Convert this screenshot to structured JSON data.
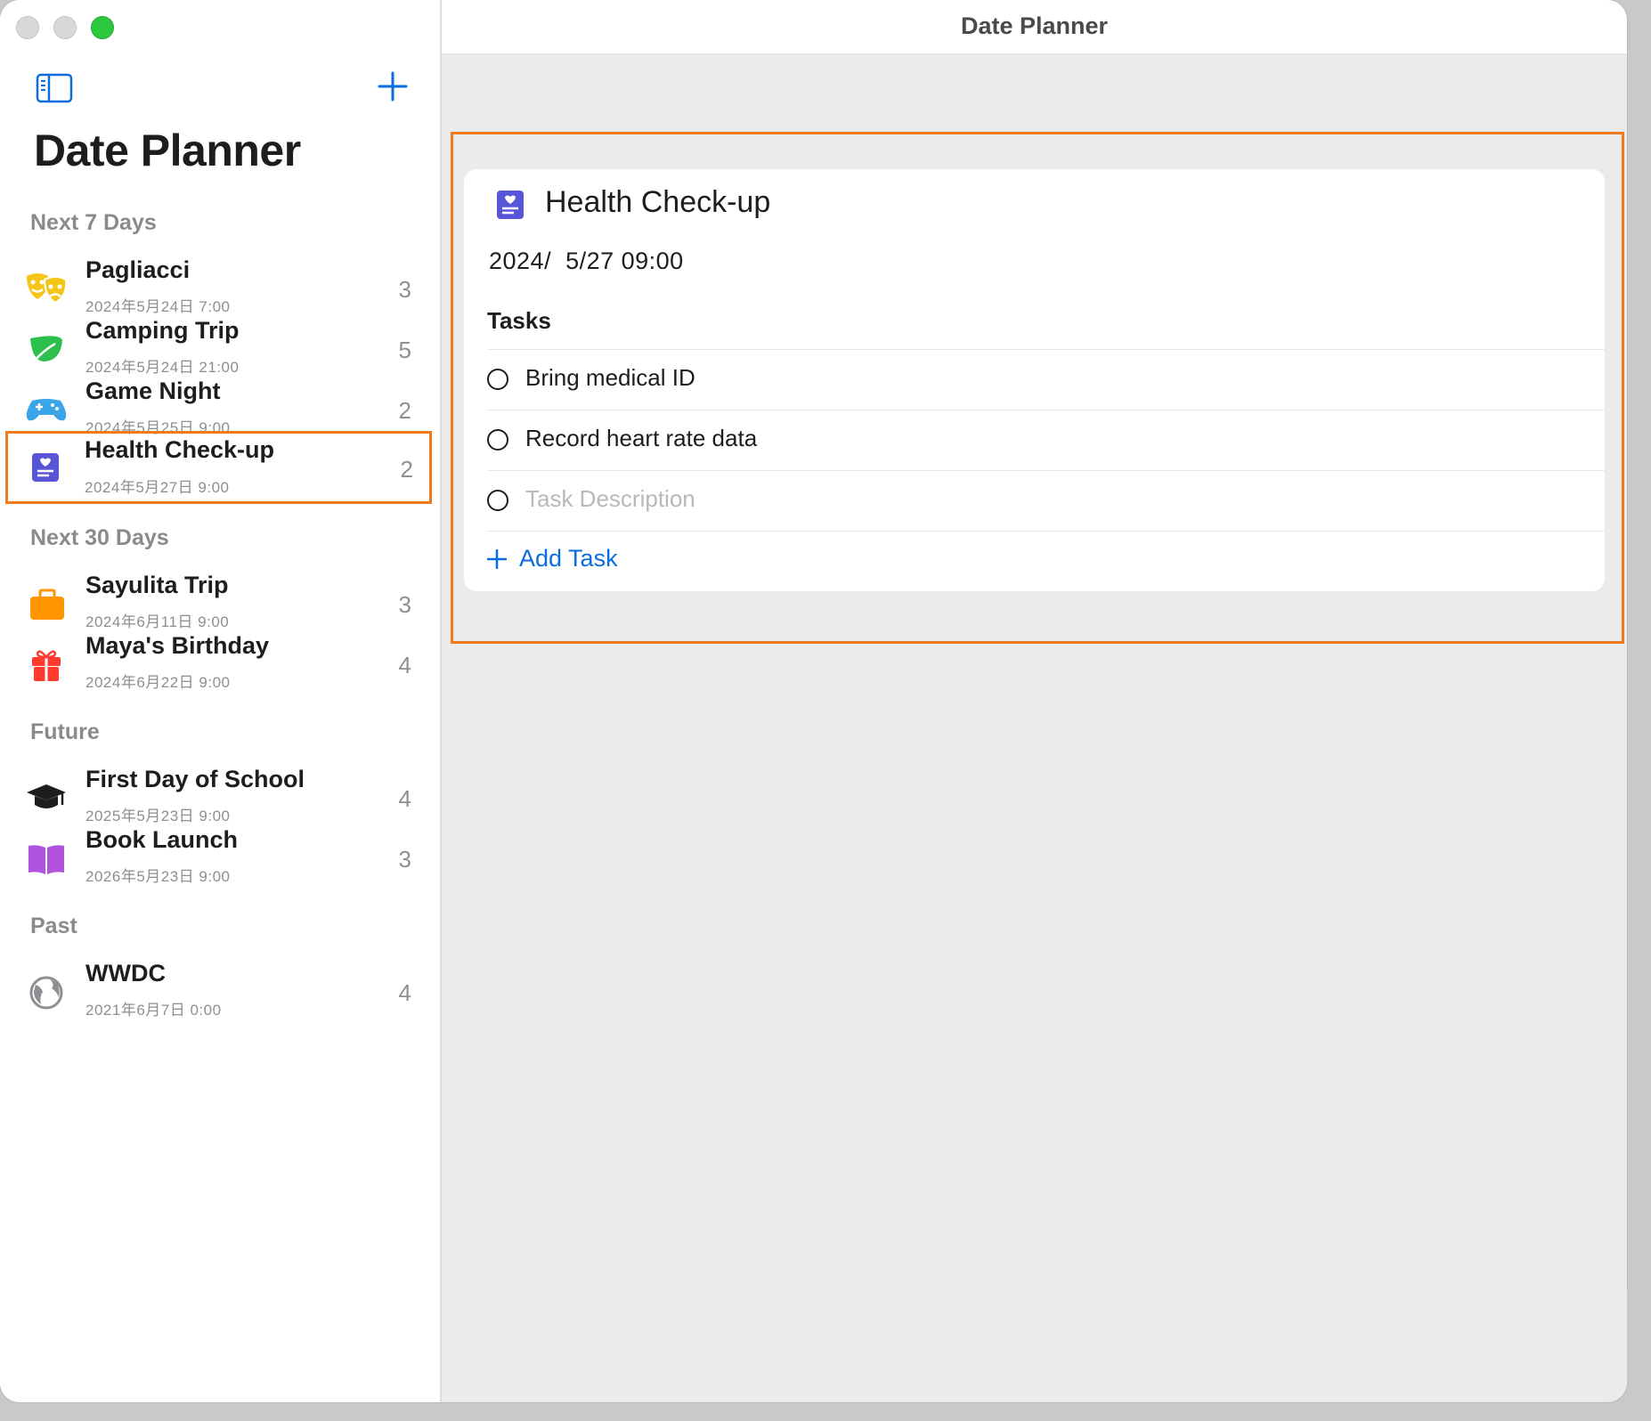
{
  "window": {
    "title": "Date Planner"
  },
  "sidebar": {
    "app_title": "Date Planner",
    "sections": [
      {
        "header": "Next 7 Days"
      },
      {
        "header": "Next 30 Days"
      },
      {
        "header": "Future"
      },
      {
        "header": "Past"
      }
    ],
    "events": [
      {
        "title": "Pagliacci",
        "date": "2024年5月24日 7:00",
        "count": "3",
        "icon": "theater-masks-icon",
        "color": "#f5c518"
      },
      {
        "title": "Camping Trip",
        "date": "2024年5月24日 21:00",
        "count": "5",
        "icon": "leaf-icon",
        "color": "#2dbf4e"
      },
      {
        "title": "Game Night",
        "date": "2024年5月25日 9:00",
        "count": "2",
        "icon": "game-controller-icon",
        "color": "#3aa5e8"
      },
      {
        "title": "Health Check-up",
        "date": "2024年5月27日 9:00",
        "count": "2",
        "icon": "medical-chart-icon",
        "color": "#5856d6",
        "selected": true
      },
      {
        "title": "Sayulita Trip",
        "date": "2024年6月11日 9:00",
        "count": "3",
        "icon": "suitcase-icon",
        "color": "#ff9500"
      },
      {
        "title": "Maya's Birthday",
        "date": "2024年6月22日 9:00",
        "count": "4",
        "icon": "gift-icon",
        "color": "#ff3b30"
      },
      {
        "title": "First Day of School",
        "date": "2025年5月23日 9:00",
        "count": "4",
        "icon": "graduation-cap-icon",
        "color": "#1d1d1f"
      },
      {
        "title": "Book Launch",
        "date": "2026年5月23日 9:00",
        "count": "3",
        "icon": "book-icon",
        "color": "#af52de"
      },
      {
        "title": "WWDC",
        "date": "2021年6月7日 0:00",
        "count": "4",
        "icon": "globe-icon",
        "color": "#8e8e93"
      }
    ]
  },
  "detail": {
    "title": "Health Check-up",
    "date": "2024/  5/27 09:00",
    "tasks_header": "Tasks",
    "tasks": [
      {
        "text": "Bring medical ID"
      },
      {
        "text": "Record heart rate data"
      }
    ],
    "new_task_placeholder": "Task Description",
    "add_task_label": "Add Task"
  },
  "colors": {
    "accent": "#0a6cde",
    "highlight": "#f07b1e"
  }
}
